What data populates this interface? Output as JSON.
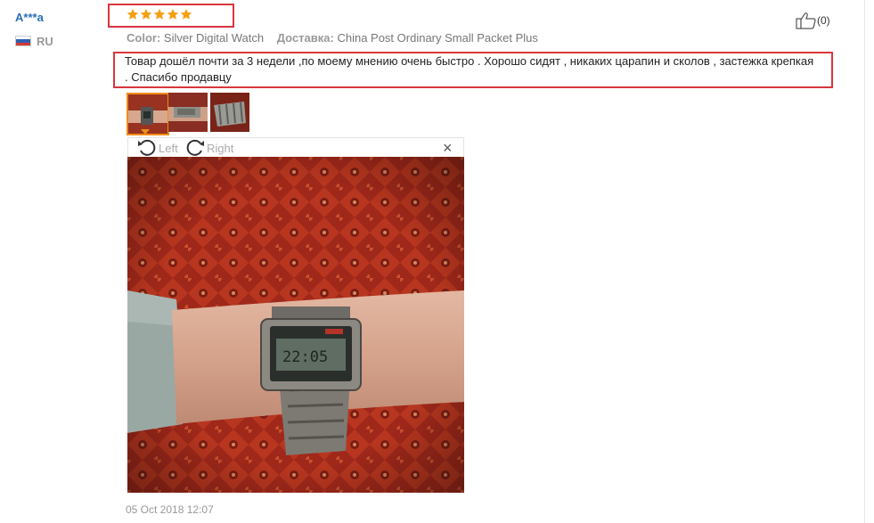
{
  "review": {
    "user": "A***a",
    "country": "RU",
    "rating": 5,
    "rating_max": 5,
    "color_label": "Color:",
    "color_value": "Silver Digital Watch",
    "shipping_label": "Доставка:",
    "shipping_value": "China Post Ordinary Small Packet Plus",
    "text": "Товар дошёл почти за 3 недели ,по моему мнению очень быстро . Хорошо сидят , никаких царапин и сколов , застежка крепкая . Спасибо продавцу",
    "likes": "(0)",
    "date": "05 Oct 2018 12:07"
  },
  "viewer": {
    "rotate_left": "Left",
    "rotate_right": "Right",
    "close": "×"
  },
  "thumbnails": [
    {
      "name": "watch-on-wrist",
      "selected": true
    },
    {
      "name": "watch-side",
      "selected": false
    },
    {
      "name": "watch-bracelet",
      "selected": false
    }
  ],
  "colors": {
    "star": "#f4a012",
    "highlight_border": "#d9363e",
    "username": "#2a6fb4",
    "thumb_selected": "#f08c1a"
  },
  "icons": {
    "like": "thumbs-up-icon",
    "rotate_left": "rotate-left-icon",
    "rotate_right": "rotate-right-icon",
    "close": "close-icon",
    "flag": "russia-flag-icon"
  }
}
